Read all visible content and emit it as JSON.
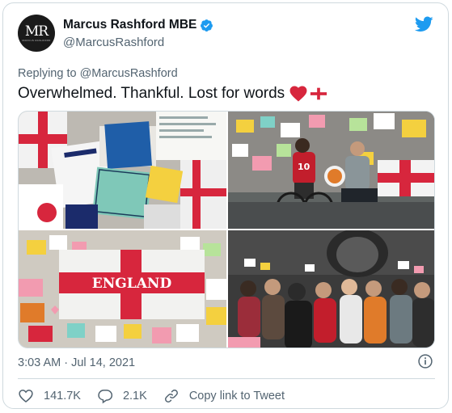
{
  "author": {
    "display_name": "Marcus Rashford MBE",
    "handle": "@MarcusRashford",
    "avatar_monogram": "MR",
    "avatar_small_text": "MARCUS RASHFORD"
  },
  "reply": {
    "prefix": "Replying to",
    "mention": "@MarcusRashford"
  },
  "tweet": {
    "text": "Overwhelmed. Thankful. Lost for words",
    "emojis": [
      "red-heart",
      "england-flag"
    ]
  },
  "photos": {
    "banner_text": "ENGLAND",
    "shirt_number": "10"
  },
  "meta": {
    "timestamp": "3:03 AM · Jul 14, 2021"
  },
  "actions": {
    "likes": "141.7K",
    "replies": "2.1K",
    "copy_link": "Copy link to Tweet"
  },
  "colors": {
    "twitter_blue": "#1d9bf0",
    "text_secondary": "#536471",
    "heart_red": "#d7263d"
  }
}
